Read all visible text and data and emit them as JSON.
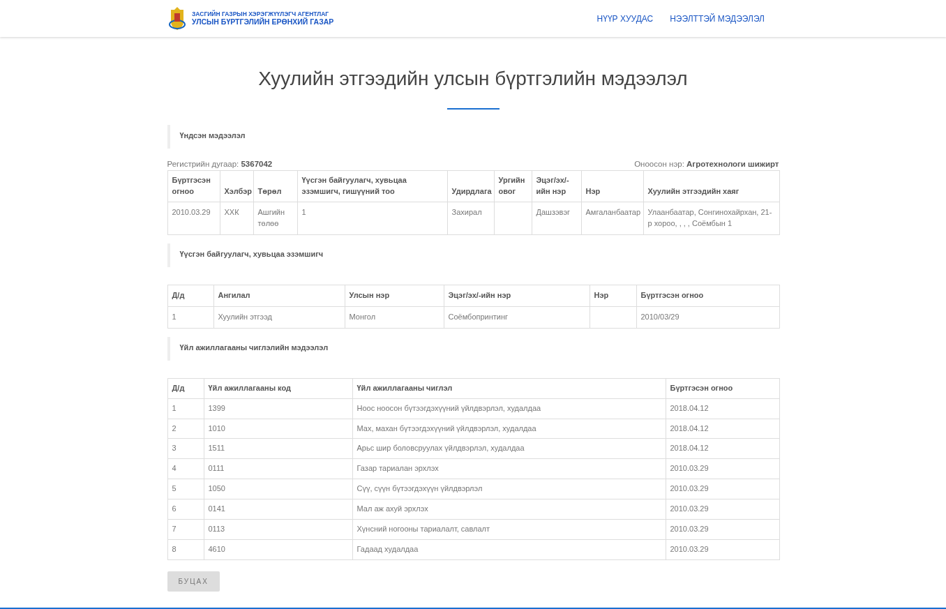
{
  "header": {
    "logo_line_1": "ЗАСГИЙН ГАЗРЫН ХЭРЭГЖҮҮЛЭГЧ АГЕНТЛАГ",
    "logo_line_2": "УЛСЫН БҮРТГЭЛИЙН ЕРӨНХИЙ ГАЗАР",
    "nav": [
      "НҮҮР ХУУДАС",
      "НЭЭЛТТЭЙ МЭДЭЭЛЭЛ"
    ]
  },
  "title": "Хуулийн этгээдийн улсын бүртгэлийн мэдээлэл",
  "sections": [
    {
      "heading": "Үндсэн мэдээлэл",
      "meta_left": "Регистрийн дугаар: **5367042**",
      "meta_right": "Оноосон нэр: **Агротехнологи шижирт**",
      "columns": [
        "Бүртгэсэн огноо",
        "Хэлбэр",
        "Төрөл",
        "Үүсгэн байгуулагч, хувьцаа эзэмшигч, гишүүний тоо",
        "Удирдлага",
        "Ургийн овог",
        "Эцэг/эх/-ийн нэр",
        "Нэр",
        "Хуулийн этгээдийн хаяг"
      ],
      "rows": [
        [
          "2010.03.29",
          "ХХК",
          "Ашгийн төлөө",
          "1",
          "Захирал",
          "",
          "Дашзэвэг",
          "Амгаланбаатар",
          "Улаанбаатар, Сонгинохайрхан, 21-р хороо, , , , Соёмбын 1"
        ]
      ]
    },
    {
      "heading": "Үүсгэн байгуулагч, хувьцаа эзэмшигч",
      "columns": [
        "Д/д",
        "Ангилал",
        "Улсын нэр",
        "Эцэг/эх/-ийн нэр",
        "Нэр",
        "Бүртгэсэн огноо"
      ],
      "rows": [
        [
          "1",
          "Хуулийн этгээд",
          "Монгол",
          "Соёмбопринтинг",
          "",
          "2010/03/29"
        ]
      ]
    },
    {
      "heading": "Үйл ажиллагааны чиглэлийн мэдээлэл",
      "columns": [
        "Д/д",
        "Үйл ажиллагааны код",
        "Үйл ажиллагааны чиглэл",
        "Бүртгэсэн огноо"
      ],
      "rows": [
        [
          "1",
          "1399",
          "Ноос ноосон бүтээгдэхүүний үйлдвэрлэл, худалдаа",
          "2018.04.12"
        ],
        [
          "2",
          "1010",
          "Мах, махан бүтээгдэхүүний үйлдвэрлэл, худалдаа",
          "2018.04.12"
        ],
        [
          "3",
          "1511",
          "Арьс шир боловсруулах үйлдвэрлэл, худалдаа",
          "2018.04.12"
        ],
        [
          "4",
          "0111",
          "Газар тариалан эрхлэх",
          "2010.03.29"
        ],
        [
          "5",
          "1050",
          "Сүү, сүүн бүтээгдэхүүн үйлдвэрлэл",
          "2010.03.29"
        ],
        [
          "6",
          "0141",
          "Мал аж ахуй эрхлэх",
          "2010.03.29"
        ],
        [
          "7",
          "0113",
          "Хүнсний ногооны тариалалт, савлалт",
          "2010.03.29"
        ],
        [
          "8",
          "4610",
          "Гадаад худалдаа",
          "2010.03.29"
        ]
      ]
    }
  ],
  "back_button": "БУЦАХ"
}
